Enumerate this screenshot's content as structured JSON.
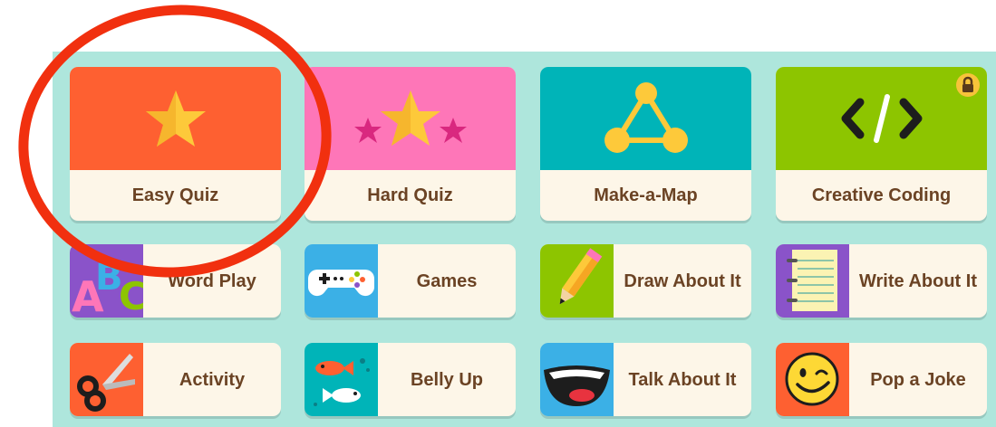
{
  "cards": [
    {
      "id": "easy-quiz",
      "label": "Easy Quiz",
      "color": "#fe6031",
      "icon": "star-icon"
    },
    {
      "id": "hard-quiz",
      "label": "Hard Quiz",
      "color": "#fe76b8",
      "icon": "stars-icon"
    },
    {
      "id": "make-a-map",
      "label": "Make-a-Map",
      "color": "#00b4b8",
      "icon": "network-triangle-icon"
    },
    {
      "id": "creative-coding",
      "label": "Creative Coding",
      "color": "#8dc500",
      "icon": "code-brackets-icon",
      "locked": true
    }
  ],
  "tiles": [
    {
      "id": "word-play",
      "label": "Word Play",
      "color": "#8a53c9",
      "icon": "abc-letters-icon"
    },
    {
      "id": "games",
      "label": "Games",
      "color": "#3bb0e6",
      "icon": "gamepad-icon"
    },
    {
      "id": "draw-about-it",
      "label": "Draw About It",
      "color": "#8dc500",
      "icon": "pencil-icon"
    },
    {
      "id": "write-about-it",
      "label": "Write About It",
      "color": "#8a53c9",
      "icon": "notepad-icon"
    },
    {
      "id": "activity",
      "label": "Activity",
      "color": "#fe6031",
      "icon": "scissors-icon"
    },
    {
      "id": "belly-up",
      "label": "Belly Up",
      "color": "#00b4b8",
      "icon": "fish-icon"
    },
    {
      "id": "talk-about-it",
      "label": "Talk About It",
      "color": "#3bb0e6",
      "icon": "mouth-icon"
    },
    {
      "id": "pop-a-joke",
      "label": "Pop a Joke",
      "color": "#fe6031",
      "icon": "wink-face-icon"
    }
  ],
  "colors": {
    "panel": "#aee6dc",
    "card_label_bg": "#fdf6e8",
    "label_text": "#6b4324",
    "annotation_circle": "#f1300f",
    "lock": "#f7c33a"
  }
}
